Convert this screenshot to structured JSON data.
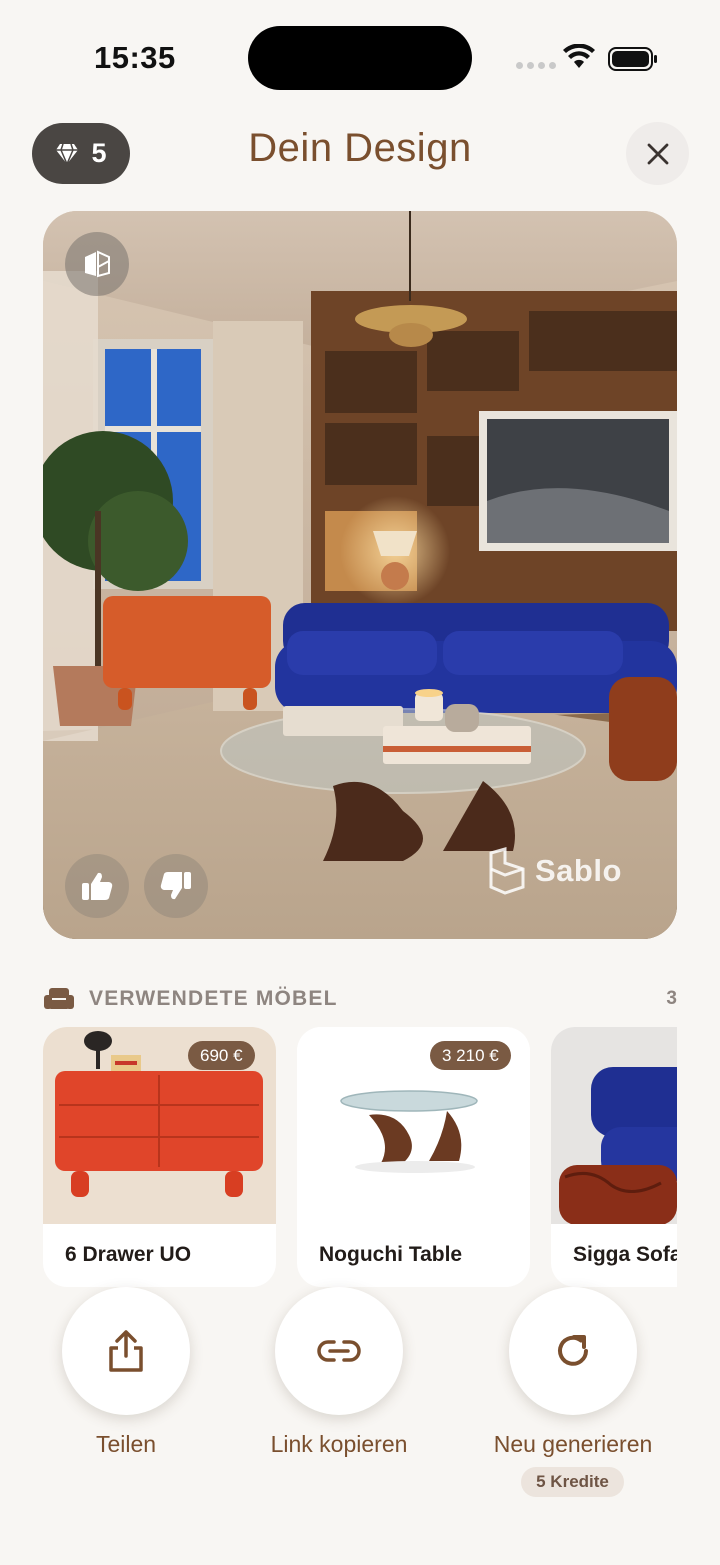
{
  "status_bar": {
    "time": "15:35"
  },
  "header": {
    "credits": "5",
    "title": "Dein Design",
    "icons": {
      "credits": "gem-icon",
      "close": "close-icon"
    }
  },
  "hero": {
    "watermark": "Sablo",
    "icons": {
      "compare": "compare-split-icon",
      "like": "thumbs-up-icon",
      "dislike": "thumbs-down-icon",
      "watermark_logo": "sablo-logo-icon"
    }
  },
  "furniture_section": {
    "title": "VERWENDETE MÖBEL",
    "count": "3",
    "icon": "sofa-icon",
    "items": [
      {
        "name": "6 Drawer UO",
        "price": "690 €"
      },
      {
        "name": "Noguchi Table",
        "price": "3 210 €"
      },
      {
        "name": "Sigga Sofa",
        "price": ""
      }
    ]
  },
  "actions": {
    "share": {
      "label": "Teilen",
      "icon": "share-icon"
    },
    "copy_link": {
      "label": "Link kopieren",
      "icon": "link-icon"
    },
    "regenerate": {
      "label": "Neu generieren",
      "icon": "refresh-icon",
      "badge": "5 Kredite"
    }
  },
  "colors": {
    "background": "#f8f6f3",
    "accent_brown": "#7a4f2e",
    "price_badge": "#7a5a43",
    "pill_dark": "#4a4643"
  }
}
